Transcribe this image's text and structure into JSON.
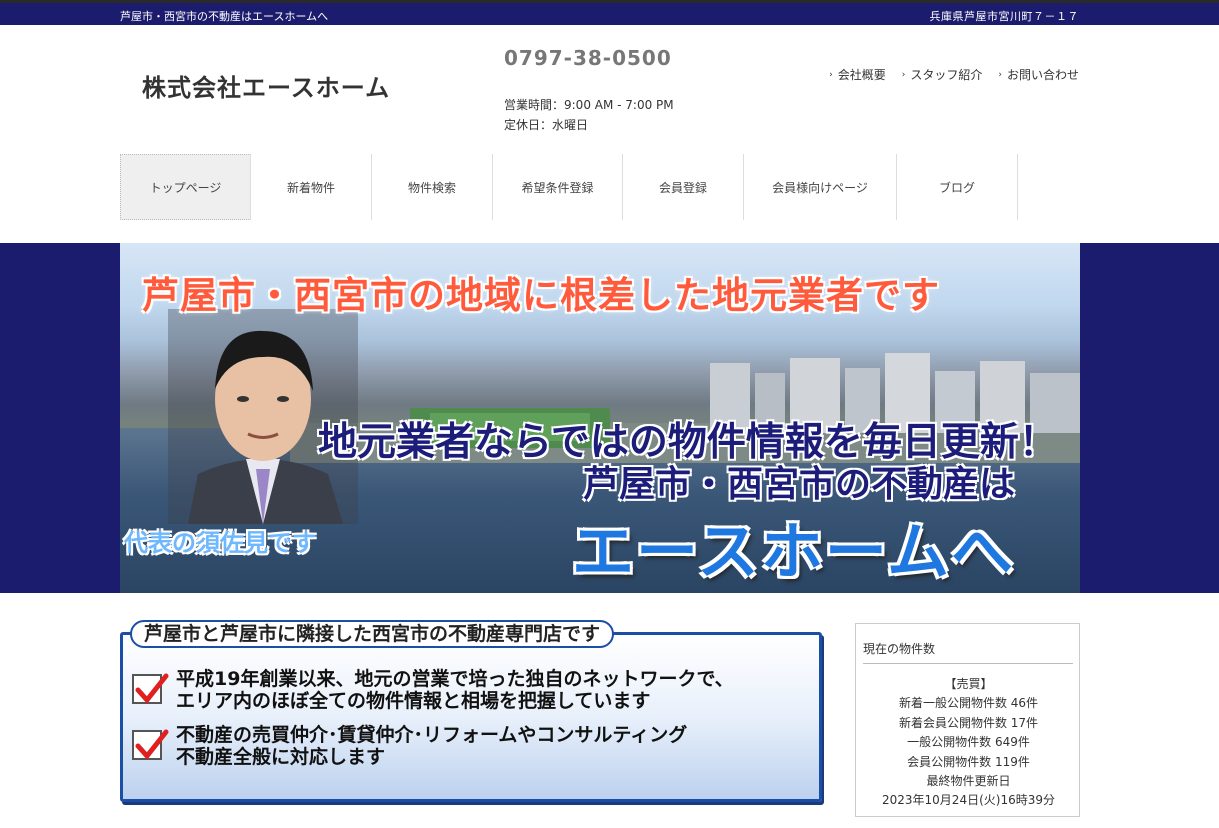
{
  "topbar": {
    "tagline": "芦屋市・西宮市の不動産はエースホームへ",
    "address": "兵庫県芦屋市宮川町７－１７"
  },
  "header": {
    "company": "株式会社エースホーム",
    "phone": "0797-38-0500",
    "hours": "営業時間：9:00 AM - 7:00 PM",
    "closed": "定休日：水曜日",
    "links": [
      "会社概要",
      "スタッフ紹介",
      "お問い合わせ"
    ]
  },
  "nav": {
    "items": [
      "トップページ",
      "新着物件",
      "物件検索",
      "希望条件登録",
      "会員登録",
      "会員様向けページ",
      "ブログ"
    ],
    "active_index": 0
  },
  "hero": {
    "headline": "芦屋市・西宮市の地域に根差した地元業者です",
    "line1": "地元業者ならではの物件情報を毎日更新！",
    "line2": "芦屋市・西宮市の不動産は",
    "brand": "エースホームへ",
    "caption": "代表の須佐見です"
  },
  "promo": {
    "title": "芦屋市と芦屋市に隣接した西宮市の不動産専門店です",
    "point1_line1": "平成19年創業以来、地元の営業で培った独自のネットワークで、",
    "point1_line2": "エリア内のほぼ全ての物件情報と相場を把握しています",
    "point2_line1": "不動産の売買仲介･賃貸仲介･リフォームやコンサルティング",
    "point2_line2": "不動産全般に対応します"
  },
  "stats": {
    "title": "現在の物件数",
    "section": "【売買】",
    "new_general": "新着一般公開物件数 46件",
    "new_member": "新着会員公開物件数 17件",
    "general": "一般公開物件数 649件",
    "member": "会員公開物件数 119件",
    "updated_label": "最終物件更新日",
    "updated": "2023年10月24日(火)16時39分"
  },
  "colors": {
    "navy": "#1c1c6e",
    "hero_headline": "#ff5a3c",
    "brand_blue": "#1e78e0",
    "check_red": "#e02020"
  }
}
